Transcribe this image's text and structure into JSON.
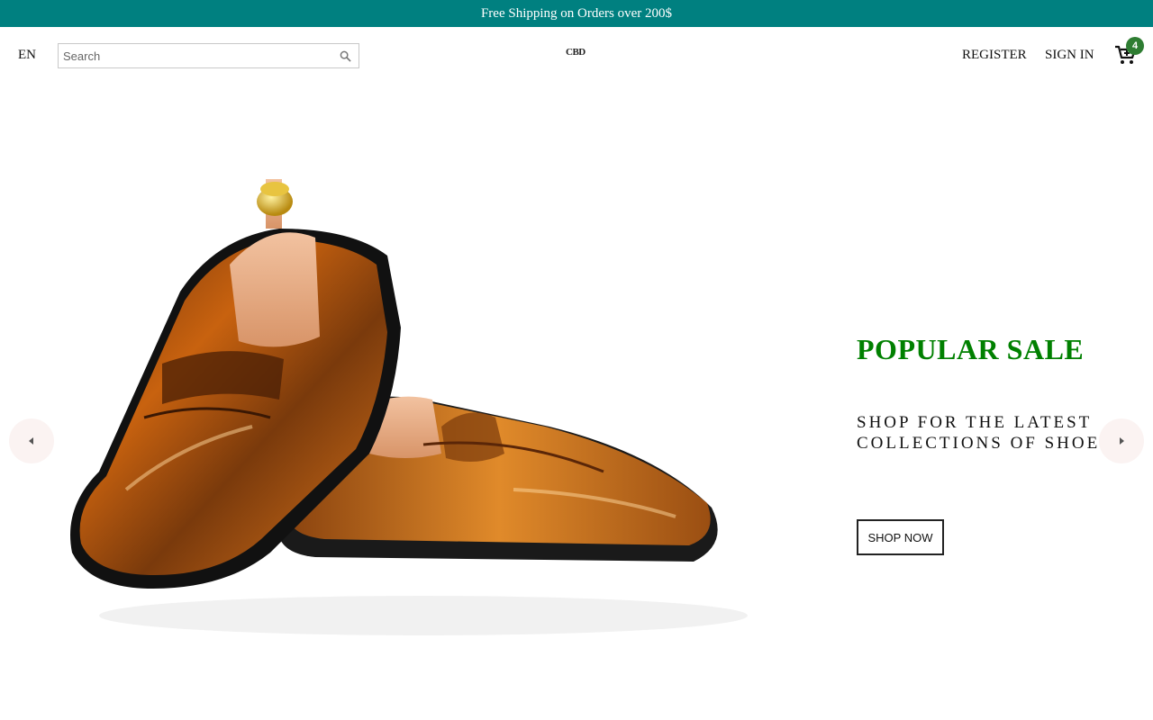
{
  "promo": {
    "text": "Free Shipping on Orders over 200$"
  },
  "header": {
    "language": "EN",
    "search": {
      "placeholder": "Search",
      "value": ""
    },
    "logo_text": "CBD",
    "register_label": "REGISTER",
    "signin_label": "SIGN IN",
    "cart_count": "4"
  },
  "hero": {
    "title": "POPULAR SALE",
    "subtitle": "SHOP FOR THE LATEST COLLECTIONS OF SHOES",
    "cta_label": "SHOP NOW",
    "image_subject": "pair of brown leather penny loafers with shoe tree"
  },
  "icons": {
    "search": "search-icon",
    "cart": "cart-icon",
    "prev": "chevron-left-icon",
    "next": "chevron-right-icon"
  },
  "colors": {
    "promo_bg": "#008080",
    "title_green": "#008000",
    "badge_green": "#2e7d32"
  }
}
